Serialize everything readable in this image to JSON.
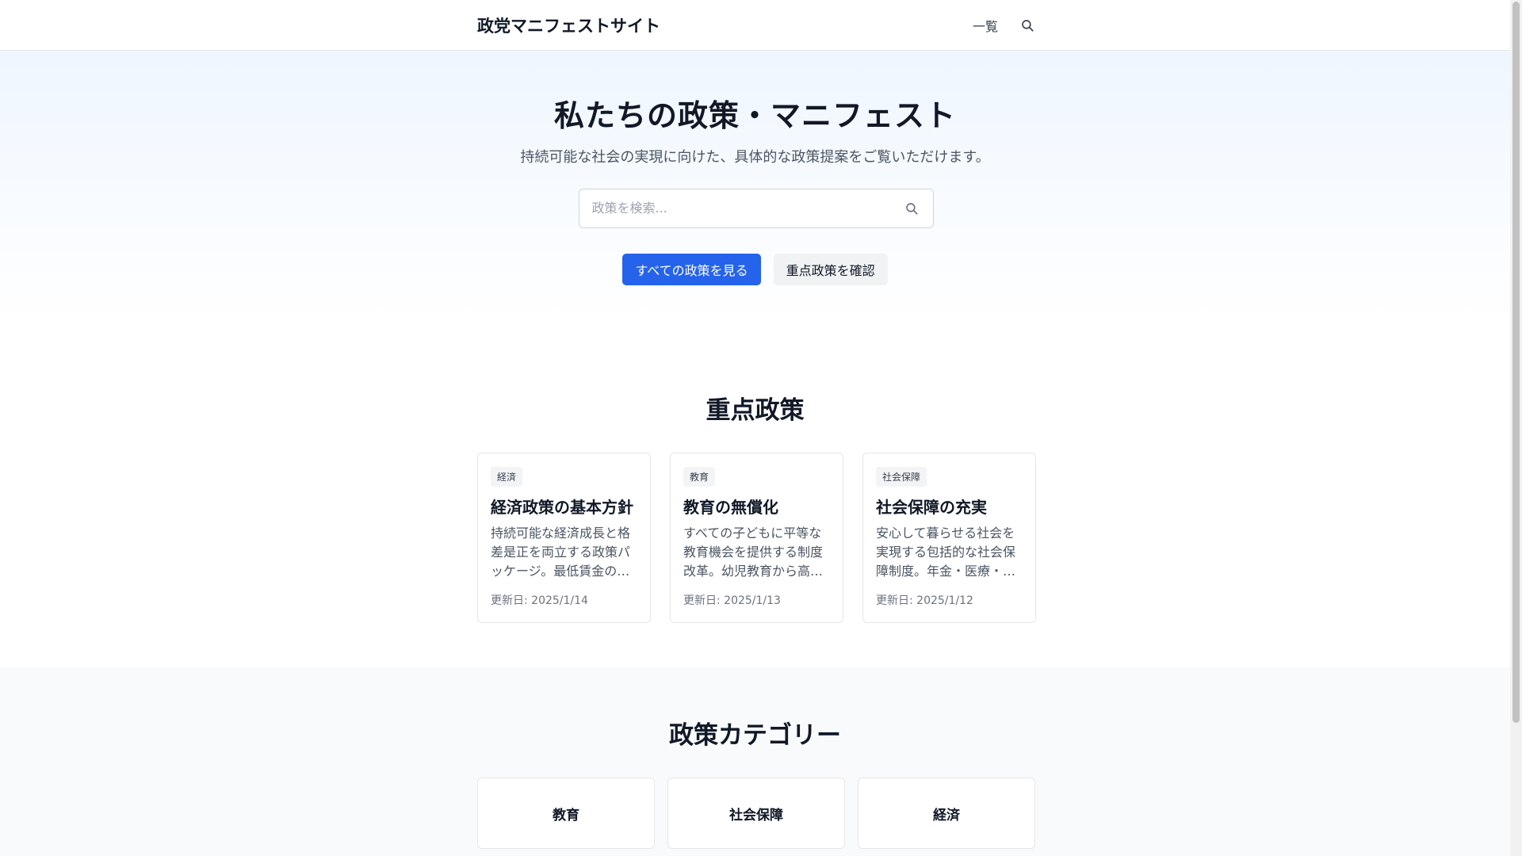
{
  "header": {
    "site_title": "政党マニフェストサイト",
    "nav_list_label": "一覧",
    "search_icon": "search-icon"
  },
  "hero": {
    "title": "私たちの政策・マニフェスト",
    "subtitle": "持続可能な社会の実現に向けた、具体的な政策提案をご覧いただけます。",
    "search_placeholder": "政策を検索...",
    "primary_button": "すべての政策を見る",
    "secondary_button": "重点政策を確認"
  },
  "featured": {
    "title": "重点政策",
    "cards": [
      {
        "tag": "経済",
        "title": "経済政策の基本方針",
        "desc": "持続可能な経済成長と格差是正を両立する政策パッケージ。最低賃金の…",
        "date": "更新日: 2025/1/14"
      },
      {
        "tag": "教育",
        "title": "教育の無償化",
        "desc": "すべての子どもに平等な教育機会を提供する制度改革。幼児教育から高…",
        "date": "更新日: 2025/1/13"
      },
      {
        "tag": "社会保障",
        "title": "社会保障の充実",
        "desc": "安心して暮らせる社会を実現する包括的な社会保障制度。年金・医療・…",
        "date": "更新日: 2025/1/12"
      }
    ]
  },
  "categories": {
    "title": "政策カテゴリー",
    "items": [
      {
        "label": "教育"
      },
      {
        "label": "社会保障"
      },
      {
        "label": "経済"
      }
    ]
  },
  "colors": {
    "accent": "#2563eb",
    "text": "#111827",
    "muted": "#6b7280"
  }
}
